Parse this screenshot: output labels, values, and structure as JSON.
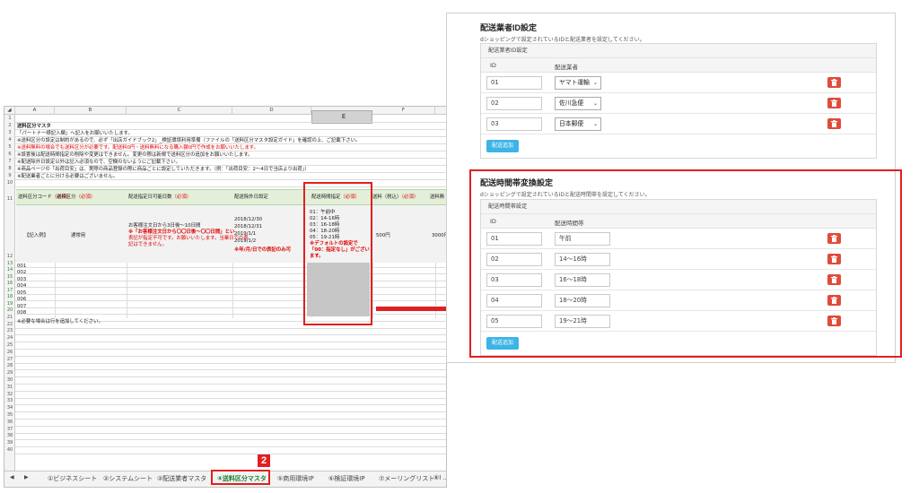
{
  "spreadsheet": {
    "columns": [
      "A",
      "B",
      "C",
      "D",
      "E",
      "F"
    ],
    "title": "送料区分マスタ",
    "notes": [
      "「パートナー様記入欄」へ記入をお願いいたします。",
      "※送料区分の設定は制約があるので、必ず「出店ガイドブック2」_検証環境利用準備（ファイルの「送料区分マスタ設定ガイド」を確認の上、ご記載下さい。",
      "※送料無料の場合でも送料区分が必要です。配送料0円・送料無料になる購入額0円で作成をお願いいたします。",
      "※設置後は配送時間指定の削除や変更はできません。変更の際は新規で送料区分の追加をお願いいたします。",
      "※配送除外日設定以外は記入必須なので、空欄のないようにご記載下さい。",
      "※商品ページの「出荷目安」は、実際の商品登録の際に商品ごとに設定していただきます。（例：「出荷目安：2～4日で当店より出荷」）",
      "※配送業者ごとに分ける必要はございません。"
    ],
    "headers": {
      "col_a": "送料区分コード",
      "col_b": "送料区分",
      "col_c": "配送指定日可能日数",
      "col_d": "配送除外日設定",
      "col_e": "配送時間指定",
      "col_f": "送料（税込）",
      "col_g": "送料無",
      "required": "（必須）"
    },
    "example_row": {
      "label": "【記入例】",
      "kubun": "通常用",
      "c_line1": "お客様注文日から3日後～10日間",
      "c_line2": "※「お客様注文日から〇〇日後～〇〇日間」とい",
      "c_line3": "表記が指定不可です。お願いいたします。当業日での表",
      "c_line4": "記はできません。",
      "dates": [
        "2018/12/30",
        "2018/12/31",
        "2019/1/1",
        "2019/1/2"
      ],
      "date_note": "※年/月/日での表記のみ可",
      "times": [
        "01：午前中",
        "02：14-16時",
        "03：16-18時",
        "04：18-20時",
        "05：19-21時"
      ],
      "time_note1": "※デフォルトの設定で",
      "time_note2": "「00：指定なし」がござい",
      "time_note3": "ます。",
      "fee": "500円",
      "free_over": "3000円"
    },
    "codes": [
      "001",
      "002",
      "003",
      "004",
      "005",
      "006",
      "007",
      "008"
    ],
    "add_note": "※必要な場合は行を追加してください。",
    "row_numbers": [
      "1",
      "2",
      "3",
      "4",
      "5",
      "6",
      "7",
      "8",
      "9",
      "10",
      "11",
      "12",
      "13",
      "14",
      "15",
      "16",
      "17",
      "18",
      "19",
      "20",
      "21",
      "22",
      "23",
      "24",
      "25",
      "26",
      "27",
      "28",
      "29",
      "30",
      "31",
      "32",
      "33",
      "34",
      "35",
      "36",
      "37",
      "38",
      "39",
      "40"
    ],
    "tabs": [
      "①ビジネスシート",
      "②システムシート",
      "③配送業者マスタ",
      "④送料区分マスタ",
      "⑤商用環境IP",
      "⑥検証環境IP",
      "⑦メーリングリスト",
      "⑧I ..."
    ],
    "active_tab": "④送料区分マスタ",
    "badge": "2"
  },
  "carrier_section": {
    "title": "配送業者ID設定",
    "description": "dショッピングで設定されているIDと配送業者を設定してください。",
    "caption": "配送業者ID設定",
    "col_id": "ID",
    "col_name": "配送業者",
    "rows": [
      {
        "id": "01",
        "carrier": "ヤマト運輸"
      },
      {
        "id": "02",
        "carrier": "佐川急便"
      },
      {
        "id": "03",
        "carrier": "日本郵便"
      }
    ],
    "add_label": "配送追加"
  },
  "time_section": {
    "title": "配送時間帯変換設定",
    "description": "dショッピングで設定されているIDと配送時間帯を設定してください。",
    "caption": "配送時間帯設定",
    "col_id": "ID",
    "col_name": "配送時間帯",
    "rows": [
      {
        "id": "01",
        "time": "午前"
      },
      {
        "id": "02",
        "time": "14〜16時"
      },
      {
        "id": "03",
        "time": "16〜18時"
      },
      {
        "id": "04",
        "time": "18〜20時"
      },
      {
        "id": "05",
        "time": "19〜21時"
      }
    ],
    "add_label": "配送追加"
  },
  "colors": {
    "highlight": "#e02020",
    "add_button": "#3cb4e6",
    "delete_button": "#e04b3a",
    "header_band": "#e3efd9"
  },
  "icons": {
    "delete": "trash-icon",
    "dropdown": "chevron-down-icon",
    "arrow": "right-arrow-icon"
  }
}
